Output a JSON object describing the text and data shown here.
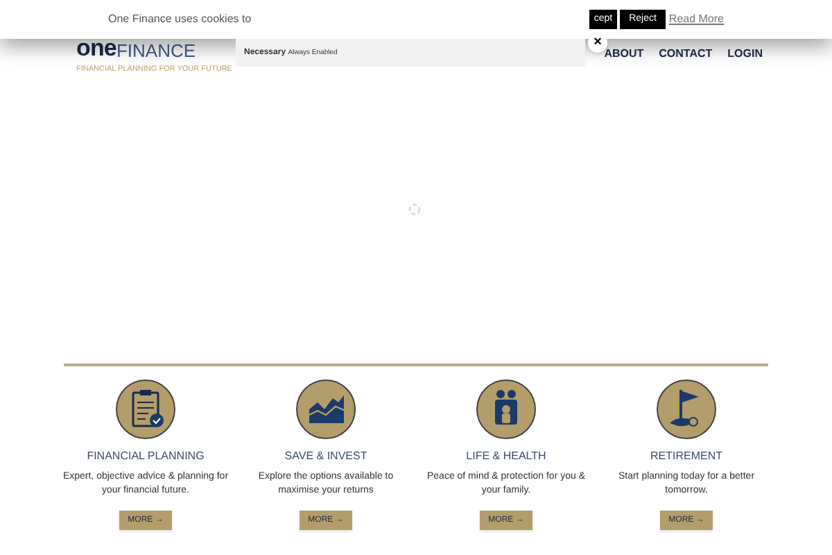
{
  "cookie_bar": {
    "message": "One Finance uses cookies to",
    "buttons": [
      {
        "label": "cept",
        "kind": "accept"
      },
      {
        "label": "Reject",
        "kind": "reject"
      }
    ],
    "link": "Read More",
    "close": "×"
  },
  "cookie_panel": {
    "title": "Necessary",
    "note": "Always Enabled"
  },
  "logo": {
    "word_1": "one",
    "word_2": "FINANCE",
    "tagline": "FINANCIAL PLANNING FOR YOUR FUTURE"
  },
  "nav": [
    "ABOUT",
    "CONTACT",
    "LOGIN"
  ],
  "services": [
    {
      "title": "FINANCIAL PLANNING",
      "text": "Expert, objective advice & planning for your financial future.",
      "button": "MORE →"
    },
    {
      "title": "SAVE & INVEST",
      "text": "Explore the options available to maximise your returns",
      "button": "MORE →"
    },
    {
      "title": "LIFE & HEALTH",
      "text": "Peace of mind & protection for you & your family.",
      "button": "MORE →"
    },
    {
      "title": "RETIREMENT",
      "text": "Start planning today for a better tomorrow.",
      "button": "MORE →"
    }
  ]
}
